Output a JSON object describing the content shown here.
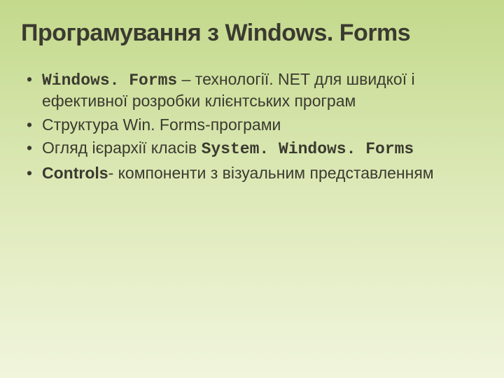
{
  "title": "Програмування з Windows. Forms",
  "bullets": [
    {
      "parts": [
        {
          "text": "Windows. Forms",
          "class": "mono"
        },
        {
          "text": " – технології. NET для швидкої і ефективної розробки клієнтських програм",
          "class": ""
        }
      ]
    },
    {
      "parts": [
        {
          "text": "Структура Win. Forms-програми",
          "class": ""
        }
      ]
    },
    {
      "parts": [
        {
          "text": "Огляд ієрархії класів ",
          "class": ""
        },
        {
          "text": "System. Windows. Forms",
          "class": "mono"
        }
      ]
    },
    {
      "parts": [
        {
          "text": "Controls",
          "class": "bold"
        },
        {
          "text": "- компоненти з візуальним представленням",
          "class": ""
        }
      ]
    }
  ]
}
